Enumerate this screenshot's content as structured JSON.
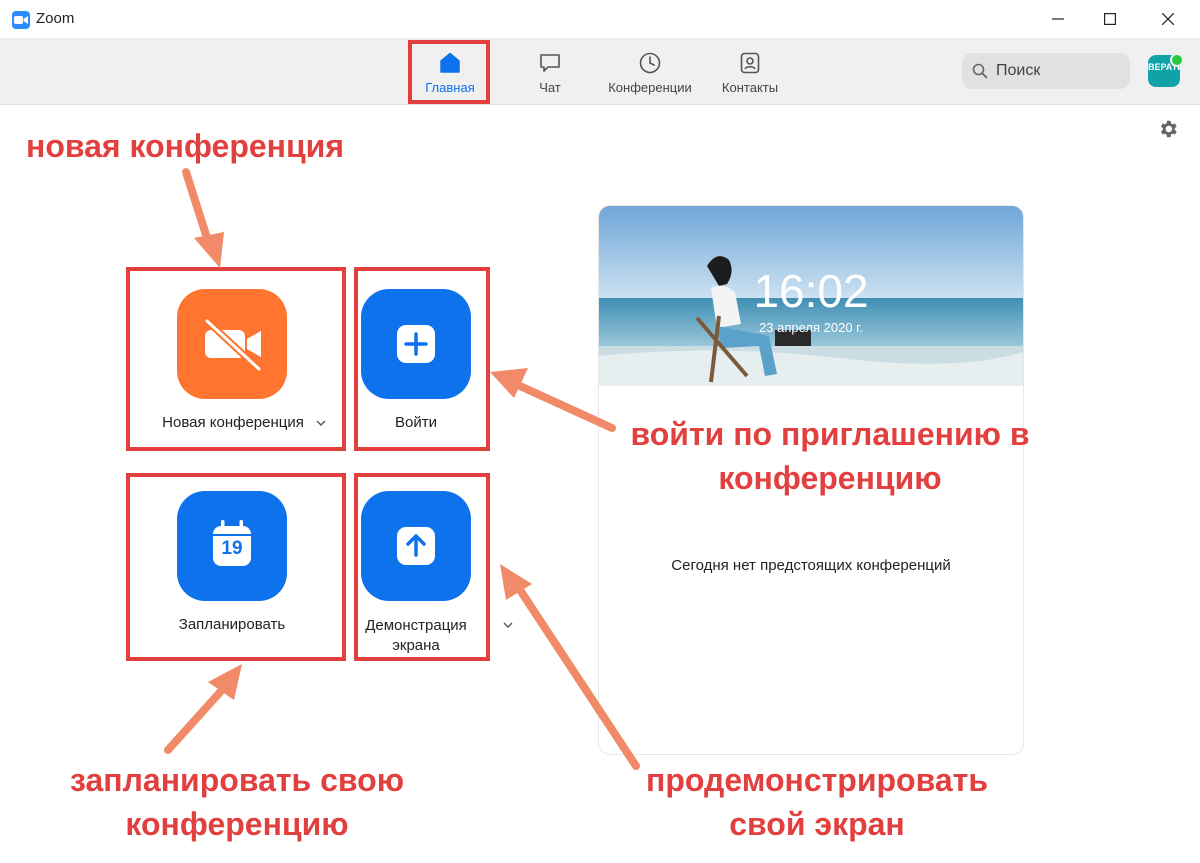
{
  "window": {
    "title": "Zoom"
  },
  "nav": {
    "tabs": [
      {
        "label": "Главная",
        "icon": "home-icon",
        "active": true
      },
      {
        "label": "Чат",
        "icon": "chat-icon",
        "active": false
      },
      {
        "label": "Конференции",
        "icon": "clock-icon",
        "active": false
      },
      {
        "label": "Контакты",
        "icon": "contacts-icon",
        "active": false
      }
    ],
    "search": {
      "placeholder": "Поиск",
      "icon": "search-icon"
    },
    "avatar": {
      "text": "ВЕРАТИ",
      "status": "online"
    }
  },
  "actions": [
    {
      "label": "Новая конференция",
      "icon": "video-off-icon",
      "color": "#ff742e",
      "has_dropdown": true
    },
    {
      "label": "Войти",
      "icon": "plus-icon",
      "color": "#0e72ed",
      "has_dropdown": false
    },
    {
      "label": "Запланировать",
      "icon": "calendar-icon",
      "calendar_day": "19",
      "color": "#0e72ed",
      "has_dropdown": false
    },
    {
      "label_line1": "Демонстрация",
      "label_line2": "экрана",
      "icon": "share-screen-icon",
      "color": "#0e72ed",
      "has_dropdown": true
    }
  ],
  "upcoming": {
    "time": "16:02",
    "date": "23 апреля 2020 г.",
    "empty_text": "Сегодня нет предстоящих конференций"
  },
  "annotations": {
    "new_meeting": "новая конференция",
    "join_line1": "войти по приглашению в",
    "join_line2": "конференцию",
    "schedule_line1": "запланировать свою",
    "schedule_line2": "конференцию",
    "share_line1": "продемонстрировать",
    "share_line2": "свой экран"
  },
  "colors": {
    "accent": "#0e72ed",
    "orange": "#ff742e",
    "annotation": "#e2403f",
    "arrow": "#f08a68"
  }
}
